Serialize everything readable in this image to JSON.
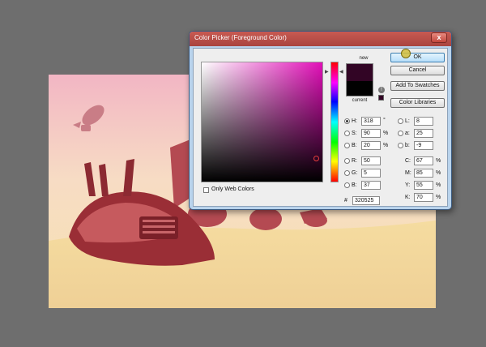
{
  "dialog": {
    "title": "Color Picker (Foreground Color)",
    "close_glyph": "x",
    "buttons": {
      "ok": "OK",
      "cancel": "Cancel",
      "add_to_swatches": "Add To Swatches",
      "color_libraries": "Color Libraries"
    },
    "swatch_labels": {
      "new": "new",
      "current": "current"
    },
    "colors": {
      "new": "#320525",
      "current": "#010101",
      "field_hue": "#e20fb8"
    },
    "hsb": [
      {
        "label": "H:",
        "value": "318",
        "unit": "°",
        "selected": true
      },
      {
        "label": "S:",
        "value": "90",
        "unit": "%",
        "selected": false
      },
      {
        "label": "B:",
        "value": "20",
        "unit": "%",
        "selected": false
      }
    ],
    "rgb": [
      {
        "label": "R:",
        "value": "50"
      },
      {
        "label": "G:",
        "value": "5"
      },
      {
        "label": "B:",
        "value": "37"
      }
    ],
    "lab": [
      {
        "label": "L:",
        "value": "8"
      },
      {
        "label": "a:",
        "value": "25"
      },
      {
        "label": "b:",
        "value": "-9"
      }
    ],
    "cmyk": [
      {
        "label": "C:",
        "value": "67",
        "unit": "%"
      },
      {
        "label": "M:",
        "value": "85",
        "unit": "%"
      },
      {
        "label": "Y:",
        "value": "55",
        "unit": "%"
      },
      {
        "label": "K:",
        "value": "70",
        "unit": "%"
      }
    ],
    "hex_label": "#",
    "hex": "320525",
    "only_web_colors": "Only Web Colors"
  }
}
